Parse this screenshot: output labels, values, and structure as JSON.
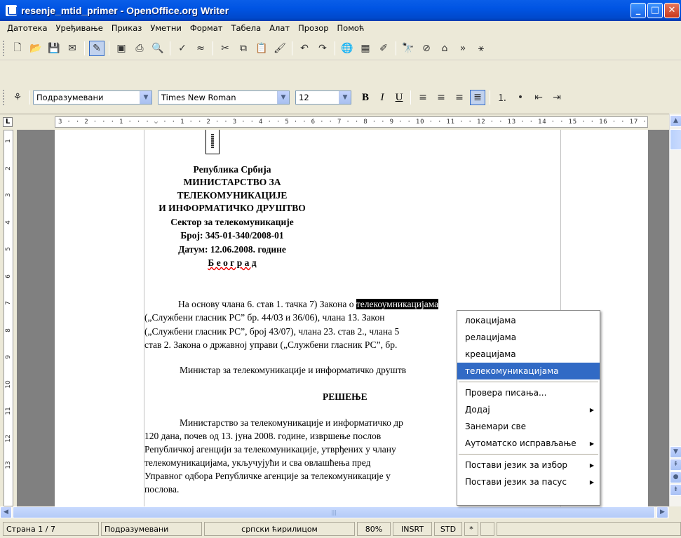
{
  "window": {
    "title": "resenje_mtid_primer - OpenOffice.org Writer"
  },
  "menubar": [
    "Датотека",
    "Уређивање",
    "Приказ",
    "Уметни",
    "Формат",
    "Табела",
    "Алат",
    "Прозор",
    "Помоћ"
  ],
  "formatting": {
    "paragraph_style": "Подразумевани",
    "font_name": "Times New Roman",
    "font_size": "12",
    "bold": "B",
    "italic": "I",
    "underline": "U"
  },
  "ruler": {
    "horizontal": "3 · · 2 · · · 1 · · · ⌵ · · 1 · · 2 · · 3 · · 4 · · 5 · · 6 · · 7 · · 8 · · 9 · · 10 · · 11 · · 12 · · 13 · · 14 · · 15 · · 16 · · 17 · · 18 ·",
    "vertical_ticks": [
      "1",
      "2",
      "3",
      "4",
      "5",
      "6",
      "7",
      "8",
      "9",
      "10",
      "11",
      "12",
      "13"
    ]
  },
  "document": {
    "header": [
      "Република Србија",
      "МИНИСТАРСТВО ЗА",
      "ТЕЛЕКОМУНИКАЦИЈЕ",
      "И ИНФОРМАТИЧКО ДРУШТВО",
      "Сектор за телекомуникације",
      "Број: 345-01-340/2008-01",
      "Датум: 12.06.2008. године",
      "Б е о г р а д"
    ],
    "para1": [
      "На основу члана 6. став 1. тачка 7) Закона о ",
      "телекоумникацијама",
      "(„Службени гласник РС” бр. 44/03 и 36/06), члана 13. Закон",
      "(„Службени гласник РС”, број 43/07), члана 23. став 2., члана 5",
      "став 2. Закона о државној управи („Службени гласник РС”, бр."
    ],
    "para2": "Министар за телекомуникације и информатичко друштв",
    "decision_title": "РЕШЕЊЕ",
    "para3": [
      "Министарство за телекомуникације и информатичко др",
      "120 дана, почев од 13. јуна 2008. године, извршење послов",
      "Републичкој агенцији за телекомуникације, утврђених у члану",
      "телекомуникацијама, укључујући и сва овлашћења пред",
      "Управног одбора Републичке агенције за телекомуникације у",
      "послова."
    ]
  },
  "context_menu": {
    "suggestions": [
      "локацијама",
      "релацијама",
      "креацијама",
      "телекомуникацијама"
    ],
    "highlighted_index": 3,
    "actions": [
      "Провера писања...",
      "Додај",
      "Занемари све",
      "Аутоматско исправљање"
    ],
    "language": [
      "Постави језик за избор",
      "Постави језик за пасус"
    ]
  },
  "statusbar": {
    "page": "Страна 1 / 7",
    "style": "Подразумевани",
    "language": "српски ћирилицом",
    "zoom": "80%",
    "insert_mode": "INSRT",
    "selection_mode": "STD",
    "modified": "*"
  },
  "colors": {
    "titlebar": "#0054e3",
    "highlight": "#316ac5",
    "chrome": "#ece9d8"
  }
}
